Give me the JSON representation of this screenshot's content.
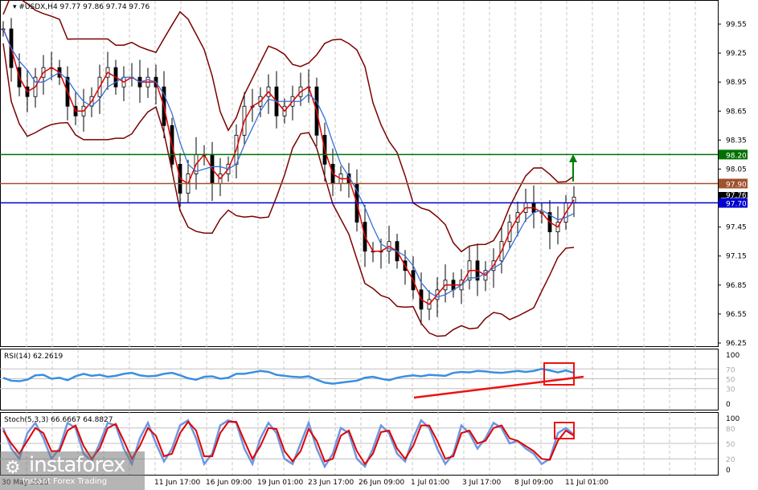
{
  "header": {
    "symbol": "#USDX,H4",
    "ohlc": "97.77 97.86 97.74 97.76"
  },
  "indicators": {
    "rsi_label": "RSI(14) 62.2619",
    "stoch_label": "Stoch(5,3,3) 66.6667 64.8827"
  },
  "logo": {
    "name": "instaforex",
    "tagline": "Instant Forex Trading"
  },
  "colors": {
    "bull": "#000000",
    "bear": "#000000",
    "bands": "#7a0000",
    "ma_fast": "#e00000",
    "ma_slow": "#3a6fd8",
    "rsi": "#3a8fe0",
    "stoch_main": "#6f96e0",
    "stoch_signal": "#e00000",
    "green": "#007000",
    "brown": "#a0522d",
    "blue": "#0000d0"
  },
  "chart_data": [
    {
      "type": "line",
      "title": "#USDX,H4 candles",
      "ylim": [
        96.25,
        99.65
      ],
      "price_ticks": [
        "99.55",
        "99.25",
        "98.95",
        "98.65",
        "98.35",
        "98.05",
        "97.75",
        "97.45",
        "97.15",
        "96.85",
        "96.55",
        "96.25"
      ],
      "closes": [
        99.5,
        99.1,
        98.9,
        98.8,
        99.0,
        99.1,
        99.1,
        99.0,
        98.7,
        98.6,
        98.7,
        98.8,
        99.0,
        99.1,
        98.9,
        99.0,
        99.0,
        98.9,
        99.0,
        98.9,
        98.5,
        98.1,
        97.8,
        98.0,
        98.2,
        98.2,
        97.9,
        98.0,
        98.1,
        98.4,
        98.7,
        98.7,
        98.8,
        98.9,
        98.6,
        98.7,
        98.8,
        98.9,
        98.9,
        98.4,
        98.1,
        97.9,
        98.0,
        97.9,
        97.5,
        97.2,
        97.2,
        97.2,
        97.3,
        97.1,
        97.0,
        96.8,
        96.6,
        96.7,
        96.8,
        96.9,
        96.8,
        96.9,
        97.1,
        96.9,
        97.0,
        97.1,
        97.3,
        97.5,
        97.6,
        97.7,
        97.6,
        97.6,
        97.4,
        97.5,
        97.7,
        97.76
      ],
      "levels": [
        {
          "value": 98.2,
          "label": "98.20",
          "color": "#007000"
        },
        {
          "value": 97.9,
          "label": "97.90",
          "color": "#a0522d"
        },
        {
          "value": 97.7,
          "label": "97.70",
          "color": "#0000d0"
        }
      ],
      "current_price_label": "97.76",
      "x_ticks": [
        "30 May 2025",
        "11 Jun 17:00",
        "16 Jun 09:00",
        "19 Jun 01:00",
        "23 Jun 17:00",
        "26 Jun 09:00",
        "1 Jul 01:00",
        "3 Jul 17:00",
        "8 Jul 09:00",
        "11 Jul 01:00"
      ]
    },
    {
      "type": "line",
      "title": "RSI(14)",
      "ylim": [
        0,
        100
      ],
      "ticks": [
        "100",
        "70",
        "50",
        "30",
        "0"
      ],
      "values": [
        52,
        46,
        45,
        48,
        57,
        58,
        50,
        52,
        47,
        55,
        60,
        56,
        58,
        54,
        56,
        60,
        62,
        57,
        55,
        56,
        60,
        62,
        57,
        51,
        48,
        54,
        55,
        50,
        52,
        60,
        60,
        63,
        66,
        64,
        58,
        56,
        54,
        53,
        55,
        48,
        42,
        40,
        42,
        44,
        46,
        52,
        54,
        50,
        47,
        52,
        55,
        57,
        55,
        58,
        57,
        56,
        62,
        64,
        63,
        66,
        65,
        63,
        62,
        64,
        66,
        64,
        66,
        70,
        67,
        63,
        67,
        62
      ],
      "trendline": [
        40,
        58
      ]
    },
    {
      "type": "line",
      "title": "Stoch(5,3,3)",
      "ylim": [
        0,
        100
      ],
      "ticks": [
        "100",
        "80",
        "50",
        "20",
        "0"
      ],
      "main": [
        80,
        40,
        20,
        70,
        90,
        60,
        20,
        40,
        90,
        80,
        30,
        15,
        50,
        90,
        85,
        40,
        10,
        60,
        90,
        50,
        15,
        40,
        85,
        95,
        60,
        10,
        30,
        85,
        95,
        90,
        40,
        10,
        60,
        90,
        70,
        20,
        10,
        50,
        90,
        40,
        5,
        30,
        80,
        70,
        20,
        5,
        40,
        85,
        70,
        30,
        15,
        60,
        95,
        80,
        40,
        10,
        30,
        85,
        70,
        40,
        60,
        90,
        80,
        50,
        55,
        40,
        30,
        10,
        20,
        70,
        80,
        67
      ],
      "signal": [
        75,
        50,
        30,
        55,
        80,
        70,
        35,
        35,
        75,
        85,
        45,
        20,
        40,
        80,
        88,
        55,
        20,
        45,
        80,
        65,
        25,
        30,
        70,
        92,
        75,
        25,
        25,
        70,
        92,
        92,
        55,
        20,
        45,
        80,
        78,
        35,
        15,
        35,
        78,
        55,
        15,
        20,
        65,
        75,
        35,
        10,
        30,
        72,
        75,
        40,
        20,
        45,
        85,
        85,
        55,
        20,
        25,
        70,
        75,
        50,
        55,
        80,
        85,
        60,
        55,
        45,
        35,
        20,
        18,
        55,
        75,
        65
      ],
      "current": [
        66.6667,
        64.8827
      ]
    }
  ]
}
